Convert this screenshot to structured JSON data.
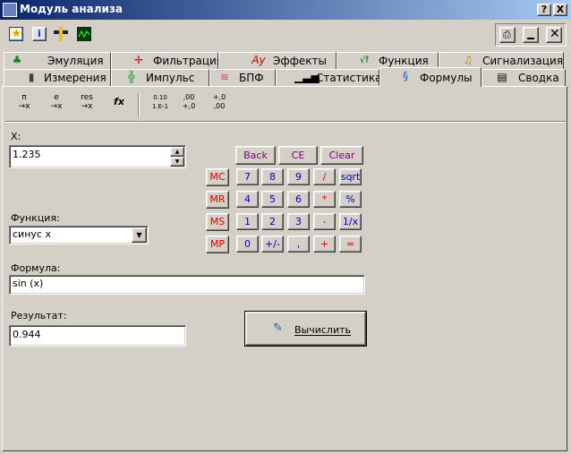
{
  "window": {
    "title": "Модуль анализа"
  },
  "titlebar_buttons": {
    "help": "?",
    "close": "X"
  },
  "toolbar_icons": [
    "star-icon",
    "info-icon",
    "ruler-icon",
    "oscilloscope-icon"
  ],
  "tabs_row1": [
    {
      "label": "Эмуляция",
      "icon": "emulation-icon"
    },
    {
      "label": "Фильтрация",
      "icon": "filter-icon"
    },
    {
      "label": "Эффекты",
      "icon": "effects-icon"
    },
    {
      "label": "Функция",
      "icon": "function-icon"
    },
    {
      "label": "Сигнализация",
      "icon": "alarm-icon"
    }
  ],
  "tabs_row2": [
    {
      "label": "Измерения",
      "icon": "measure-icon"
    },
    {
      "label": "Импульс",
      "icon": "pulse-icon"
    },
    {
      "label": "БПФ",
      "icon": "fft-icon"
    },
    {
      "label": "Статистика",
      "icon": "statistics-icon"
    },
    {
      "label": "Формулы",
      "icon": "formula-icon",
      "active": true
    },
    {
      "label": "Сводка",
      "icon": "summary-icon"
    }
  ],
  "formula_toolbar": [
    {
      "top": "π",
      "bottom": "→x",
      "name": "pi-to-x-button"
    },
    {
      "top": "e",
      "bottom": "→x",
      "name": "e-to-x-button"
    },
    {
      "top": "res",
      "bottom": "→x",
      "name": "res-to-x-button"
    },
    {
      "top": "fx",
      "bottom": "",
      "name": "function-button"
    },
    {
      "top": "0.10",
      "bottom": "1.E-1",
      "name": "exponential-format-button"
    },
    {
      "top": ",00",
      "bottom": "+,0",
      "name": "add-decimal-button"
    },
    {
      "top": "+,0",
      "bottom": ",00",
      "name": "remove-decimal-button"
    }
  ],
  "x_field": {
    "label": "X:",
    "value": "1.235"
  },
  "function_field": {
    "label": "Функция:",
    "value": "синус x"
  },
  "formula_field": {
    "label": "Формула:",
    "value": "sin (x)"
  },
  "result_field": {
    "label": "Результат:",
    "value": "0.944"
  },
  "calculate_button": {
    "label": "Вычислить",
    "accel": "В"
  },
  "calc_top": [
    "Back",
    "CE",
    "Clear"
  ],
  "memory_keys": [
    "MC",
    "MR",
    "MS",
    "MP"
  ],
  "keypad_rows": [
    [
      "7",
      "8",
      "9",
      "/",
      "sqrt"
    ],
    [
      "4",
      "5",
      "6",
      "*",
      "%"
    ],
    [
      "1",
      "2",
      "3",
      "-",
      "1/x"
    ],
    [
      "0",
      "+/-",
      ",",
      "+",
      "="
    ]
  ],
  "colors": {
    "title_start": "#0a246a",
    "title_end": "#a6caf0",
    "digit": "#0000c0",
    "op": "#e00000",
    "top": "#800080"
  }
}
